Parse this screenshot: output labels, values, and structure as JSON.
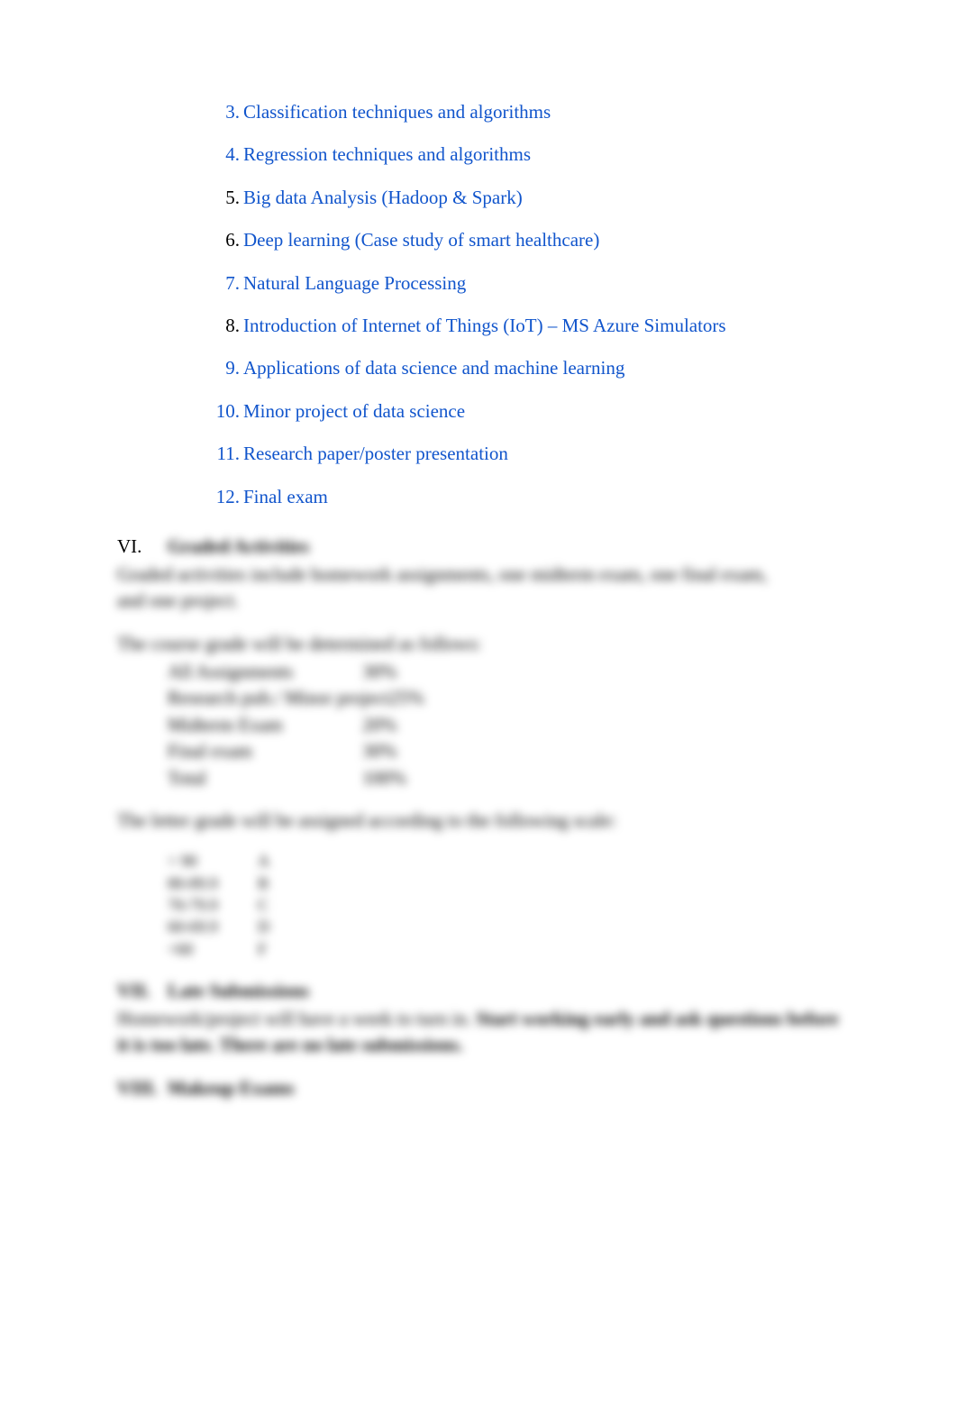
{
  "topics": [
    {
      "num": "3.",
      "text": "Classification techniques and algorithms",
      "numClass": "num-blue",
      "textClass": "link-blue"
    },
    {
      "num": "4.",
      "text": "Regression techniques and algorithms",
      "numClass": "num-blue",
      "textClass": "link-blue"
    },
    {
      "num": "5.",
      "text": "Big data Analysis (Hadoop & Spark)",
      "numClass": "num-black",
      "textClass": "link-blue"
    },
    {
      "num": "6.",
      "text": "Deep learning (Case study of smart healthcare)",
      "numClass": "num-black",
      "textClass": "link-blue"
    },
    {
      "num": "7.",
      "text": "Natural Language Processing",
      "numClass": "num-blue",
      "textClass": "link-blue"
    },
    {
      "num": "8.",
      "text": "Introduction of Internet of Things (IoT) – MS Azure Simulators",
      "numClass": "num-black",
      "textClass": "link-blue"
    },
    {
      "num": "9.",
      "text": "Applications of data science and machine learning",
      "numClass": "num-blue",
      "textClass": "link-blue"
    },
    {
      "num": "10.",
      "text": "Minor project of data science",
      "numClass": "num-blue",
      "textClass": "link-blue"
    },
    {
      "num": "11.",
      "text": "Research paper/poster presentation",
      "numClass": "num-blue",
      "textClass": "link-blue"
    },
    {
      "num": "12.",
      "text": "Final exam",
      "numClass": "num-blue",
      "textClass": "link-blue"
    }
  ],
  "sectionVI": {
    "roman": "VI.",
    "title": "Graded Activities",
    "body1": "Graded activities include homework assignments, one midterm exam, one final exam,",
    "body2": "and one project."
  },
  "gradeIntro": "The course grade will be determined as follows:",
  "gradeBreakdown": [
    {
      "label": "All Assignments",
      "val": "30%"
    },
    {
      "label": "Research pub./ Minor project",
      "val": "25%"
    },
    {
      "label": "Midterm Exam",
      "val": "20%"
    },
    {
      "label": "Final exam",
      "val": "30%"
    },
    {
      "label": "Total",
      "val": "100%"
    }
  ],
  "letterIntro": "The letter grade will be assigned according to the following scale:",
  "letterScale": [
    {
      "range": "> 90",
      "grade": "A"
    },
    {
      "range": "80-89.9",
      "grade": "B"
    },
    {
      "range": "70-79.9",
      "grade": "C"
    },
    {
      "range": "60-69.9",
      "grade": "D"
    },
    {
      "range": "<60",
      "grade": "F"
    }
  ],
  "sectionVII": {
    "roman": "VII.",
    "title": "Late Submissions",
    "body1a": "Homework/project will have a week to turn in.",
    "body1b": " Start working early and ask questions before",
    "body2": "it is too late. There are no late submissions."
  },
  "sectionVIII": {
    "roman": "VIII.",
    "title": "Makeup Exams"
  }
}
